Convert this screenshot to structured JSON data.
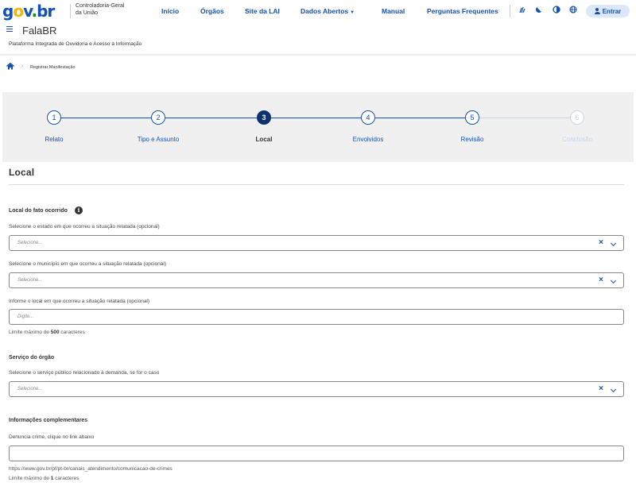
{
  "header": {
    "logo": {
      "g": "g",
      "o": "o",
      "v": "v",
      "dot": ".",
      "br": "br"
    },
    "org_line1": "Controladoria-Geral",
    "org_line2": "da União",
    "nav": [
      {
        "label": "Início"
      },
      {
        "label": "Órgãos"
      },
      {
        "label": "Site da LAI"
      },
      {
        "label": "Dados Abertos"
      },
      {
        "label": "Manual"
      },
      {
        "label": "Perguntas Frequentes"
      }
    ],
    "tools": [
      "sign-language-icon",
      "contrast-icon",
      "contrast-toggle-icon",
      "globe-icon"
    ],
    "login_label": "Entrar",
    "app_title": "FalaBR",
    "app_subtitle": "Plataforma Integrada de Ouvidoria e Acesso à Informação"
  },
  "breadcrumb": {
    "current": "Registrar Manifestação"
  },
  "stepper": {
    "steps": [
      {
        "number": "1",
        "label": "Relato",
        "state": "done"
      },
      {
        "number": "2",
        "label": "Tipo e Assunto",
        "state": "done"
      },
      {
        "number": "3",
        "label": "Local",
        "state": "active"
      },
      {
        "number": "4",
        "label": "Envolvidos",
        "state": "pending"
      },
      {
        "number": "5",
        "label": "Revisão",
        "state": "pending"
      },
      {
        "number": "6",
        "label": "Conclusão",
        "state": "disabled"
      }
    ]
  },
  "form": {
    "section_title": "Local",
    "local": {
      "title": "Local do fato ocorrido",
      "estado_label": "Selecione o estado em que ocorreu a situação relatada (opcional)",
      "estado_placeholder": "Selecione...",
      "municipio_label": "Selecione o município em que ocorreu a situação relatada (opcional)",
      "municipio_placeholder": "Selecione...",
      "localdesc_label": "Informe o local em que ocorreu a situação relatada (opcional)",
      "localdesc_placeholder": "Digite...",
      "limit_prefix": "Limite máximo de ",
      "limit_value": "500",
      "limit_suffix": " caracteres"
    },
    "servico": {
      "title": "Serviço do órgão",
      "label": "Selecione o serviço público relacionado à demanda, se for o caso",
      "placeholder": "Selecione..."
    },
    "info": {
      "title": "Informações complementares",
      "label": "Denuncia crime, clique no link abaixo",
      "value": "",
      "link": "https://www.gov.br/pf/pt-br/canais_atendimento/comunicacao-de-crimes",
      "limit_prefix": "Limite máximo de ",
      "limit_value": "1",
      "limit_suffix": " caracteres"
    }
  },
  "colors": {
    "primary": "#1351b4",
    "active_step": "#0c326f",
    "stepper_bg": "#f0f0f0"
  }
}
